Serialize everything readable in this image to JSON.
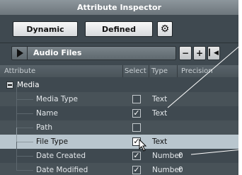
{
  "window": {
    "title": "Attribute Inspector"
  },
  "toolbar": {
    "dynamic_label": "Dynamic",
    "defined_label": "Defined"
  },
  "pathbar": {
    "label": "Audio Files",
    "minus_label": "−",
    "plus_label": "+"
  },
  "columns": {
    "attribute": "Attribute",
    "select": "Select",
    "type": "Type",
    "precision": "Precision"
  },
  "group": {
    "label": "Media"
  },
  "rows": [
    {
      "label": "Media Type",
      "checked": false,
      "type": "Text",
      "precision": ""
    },
    {
      "label": "Name",
      "checked": true,
      "type": "Text",
      "precision": ""
    },
    {
      "label": "Path",
      "checked": false,
      "type": "",
      "precision": ""
    },
    {
      "label": "File Type",
      "checked": true,
      "type": "Text",
      "precision": ""
    },
    {
      "label": "Date Created",
      "checked": true,
      "type": "Number",
      "precision": "0"
    },
    {
      "label": "Date Modified",
      "checked": true,
      "type": "Number",
      "precision": "0"
    }
  ],
  "colors": {
    "panel_bg": "#3f4950",
    "selected_row": "#b9c6ce",
    "titlebar": "#7d868c"
  }
}
